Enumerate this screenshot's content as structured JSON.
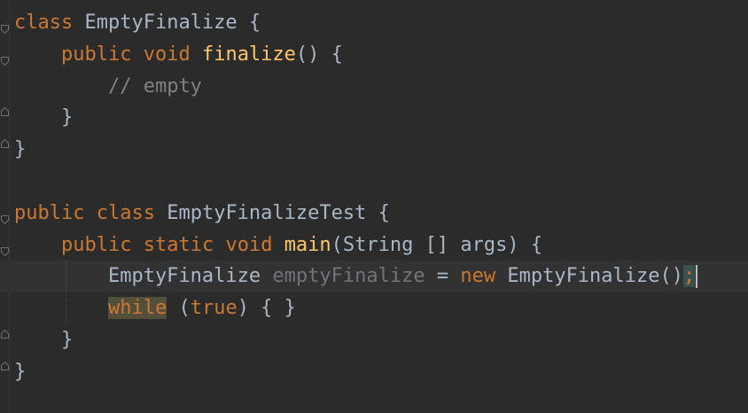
{
  "editor": {
    "colors": {
      "background": "#2b2b2b",
      "keyword": "#cc7832",
      "function": "#ffc66d",
      "comment": "#808080",
      "text": "#a9b7c6",
      "unused_variable": "#72737a"
    },
    "lines": [
      {
        "tokens": [
          {
            "t": "class",
            "c": "kw"
          },
          {
            "t": " EmptyFinalize {",
            "c": "plain"
          }
        ]
      },
      {
        "tokens": [
          {
            "t": "    "
          },
          {
            "t": "public",
            "c": "kw"
          },
          {
            "t": " "
          },
          {
            "t": "void",
            "c": "kw"
          },
          {
            "t": " "
          },
          {
            "t": "finalize",
            "c": "fn"
          },
          {
            "t": "() {",
            "c": "plain"
          }
        ]
      },
      {
        "tokens": [
          {
            "t": "        "
          },
          {
            "t": "// empty",
            "c": "cm"
          }
        ]
      },
      {
        "tokens": [
          {
            "t": "    }",
            "c": "plain"
          }
        ]
      },
      {
        "tokens": [
          {
            "t": "}",
            "c": "plain"
          }
        ]
      },
      {
        "tokens": []
      },
      {
        "tokens": [
          {
            "t": "public",
            "c": "kw"
          },
          {
            "t": " "
          },
          {
            "t": "class",
            "c": "kw"
          },
          {
            "t": " EmptyFinalizeTest {",
            "c": "plain"
          }
        ]
      },
      {
        "tokens": [
          {
            "t": "    "
          },
          {
            "t": "public",
            "c": "kw"
          },
          {
            "t": " "
          },
          {
            "t": "static",
            "c": "kw"
          },
          {
            "t": " "
          },
          {
            "t": "void",
            "c": "kw"
          },
          {
            "t": " "
          },
          {
            "t": "main",
            "c": "fn"
          },
          {
            "t": "(String [] args) {",
            "c": "plain"
          }
        ]
      },
      {
        "current": true,
        "tokens": [
          {
            "t": "        EmptyFinalize ",
            "c": "plain"
          },
          {
            "t": "emptyFinalize",
            "c": "unused"
          },
          {
            "t": " = ",
            "c": "plain"
          },
          {
            "t": "new",
            "c": "kw"
          },
          {
            "t": " EmptyFinalize()",
            "c": "plain"
          },
          {
            "t": ";",
            "c": "kw semi-hl"
          },
          {
            "caret": true
          }
        ]
      },
      {
        "tokens": [
          {
            "t": "        "
          },
          {
            "t": "while",
            "c": "kw while-hl"
          },
          {
            "t": " ("
          },
          {
            "t": "true",
            "c": "kw"
          },
          {
            "t": ") { }",
            "c": "plain"
          }
        ]
      },
      {
        "tokens": [
          {
            "t": "    }",
            "c": "plain"
          }
        ]
      },
      {
        "tokens": [
          {
            "t": "}",
            "c": "plain"
          }
        ]
      }
    ],
    "fold_markers": [
      {
        "line": 0,
        "dir": "open"
      },
      {
        "line": 1,
        "dir": "open"
      },
      {
        "line": 3,
        "dir": "close"
      },
      {
        "line": 4,
        "dir": "close"
      },
      {
        "line": 6,
        "dir": "open"
      },
      {
        "line": 7,
        "dir": "open"
      },
      {
        "line": 10,
        "dir": "close"
      },
      {
        "line": 11,
        "dir": "close"
      }
    ]
  }
}
